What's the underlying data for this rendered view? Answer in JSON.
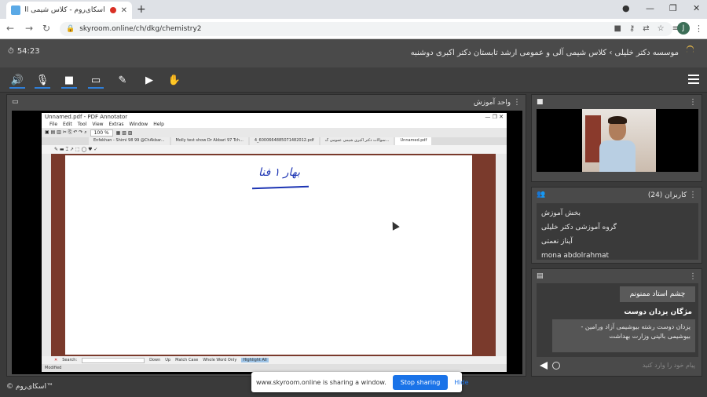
{
  "browser": {
    "tab_title": "اسکای‌روم - کلاس شیمی آلی",
    "new_tab": "+",
    "url": "skyroom.online/ch/dkg/chemistry2",
    "account_initial": "J"
  },
  "app": {
    "timer": "54:23",
    "breadcrumb": "موسسه دکتر خلیلی › کلاس شیمی آلی و عمومی ارشد تابستان دکتر اکبری دوشنبه"
  },
  "share_panel": {
    "title": "واحد آموزش"
  },
  "pdf": {
    "title": "Unnamed.pdf - PDF Annotator",
    "menu": [
      "File",
      "Edit",
      "Tool",
      "View",
      "Extras",
      "Window",
      "Help"
    ],
    "zoom": "100 %",
    "tabs": [
      "Enfekhan - Shimi 98 99 @ChAkbar...",
      "Molly test show Dr Akbari 97 Tch...",
      "4_6000664885071482012.pdf",
      "سوالات دکتر اکبری شیمی عمومی ک...",
      "Unnamed.pdf"
    ],
    "active_tab": 4,
    "ink_text": "بهار ۱ فنا",
    "find_label": "Search:",
    "find_down": "Down",
    "find_up": "Up",
    "match_case": "Match Case",
    "whole_word": "Whole Word Only",
    "highlight_all": "Highlight All",
    "status": "Modified"
  },
  "users": {
    "title": "کاربران (24)",
    "list": [
      "بخش آموزش",
      "گروه آموزشی دکتر خلیلی",
      "آیناز نعمتی",
      "mona abdolrahmat"
    ]
  },
  "chat": {
    "msg1": "چشم استاد ممنونم",
    "sender": "مژگان یزدان دوست",
    "msg2": "یزدان دوست       رشته بیوشیمی آزاد ورامین - بیوشیمی بالینی وزارت بهداشت",
    "input_placeholder": "پیام خود را وارد کنید"
  },
  "share_bar": {
    "text": "www.skyroom.online is sharing a window.",
    "stop": "Stop sharing",
    "hide": "Hide"
  },
  "footer": {
    "brand": "© اسکای‌روم™"
  },
  "colors": {
    "accent": "#1a73e8",
    "ink": "#1c34b3",
    "user_icon": "#f2c24a"
  }
}
